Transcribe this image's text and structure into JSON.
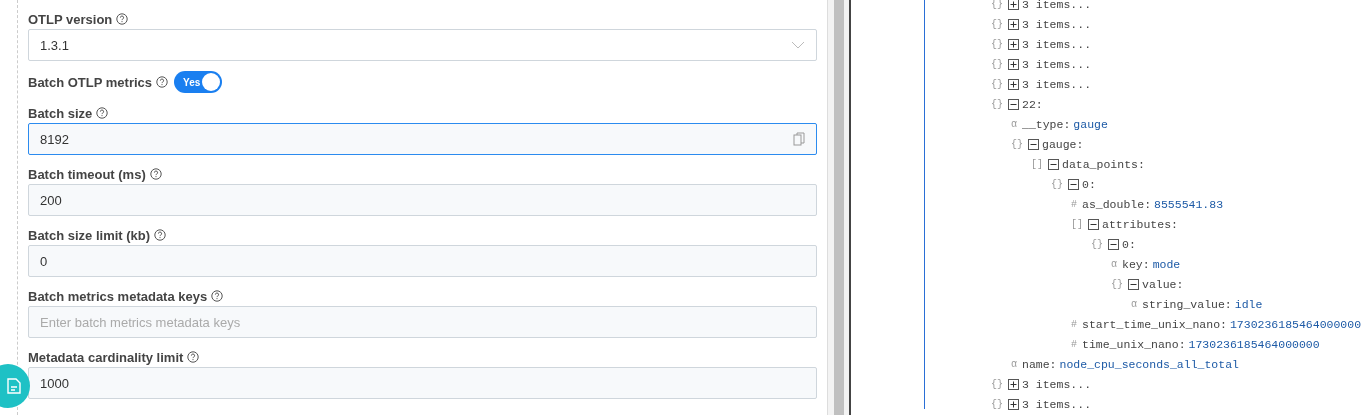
{
  "form": {
    "fields": [
      {
        "label": "OTLP version",
        "kind": "select",
        "value": "1.3.1",
        "focused": false
      },
      {
        "label": "Batch OTLP metrics",
        "kind": "toggle",
        "on": true,
        "toggle_text": "Yes"
      },
      {
        "label": "Batch size",
        "kind": "input",
        "value": "8192",
        "focused": true
      },
      {
        "label": "Batch timeout (ms)",
        "kind": "input",
        "value": "200",
        "focused": false
      },
      {
        "label": "Batch size limit (kb)",
        "kind": "input",
        "value": "0",
        "focused": false
      },
      {
        "label": "Batch metrics metadata keys",
        "kind": "input",
        "placeholder": "Enter batch metrics metadata keys",
        "focused": false
      },
      {
        "label": "Metadata cardinality limit",
        "kind": "input",
        "value": "1000",
        "focused": false
      }
    ]
  },
  "tree": [
    {
      "icon": "{}",
      "text": "3 items...",
      "expanded": false
    },
    {
      "icon": "{}",
      "text": "3 items...",
      "expanded": false
    },
    {
      "icon": "{}",
      "text": "3 items...",
      "expanded": false
    },
    {
      "icon": "{}",
      "text": "3 items...",
      "expanded": false
    },
    {
      "icon": "{}",
      "text": "3 items...",
      "expanded": false
    },
    {
      "icon": "{}",
      "text": "22:",
      "expanded": true,
      "children": [
        {
          "icon": "α",
          "text": "__type:",
          "value": "gauge"
        },
        {
          "icon": "{}",
          "text": "gauge:",
          "expanded": true,
          "children": [
            {
              "icon": "[]",
              "text": "data_points:",
              "expanded": true,
              "children": [
                {
                  "icon": "{}",
                  "text": "0:",
                  "expanded": true,
                  "children": [
                    {
                      "icon": "#",
                      "text": "as_double:",
                      "value": "8555541.83"
                    },
                    {
                      "icon": "[]",
                      "text": "attributes:",
                      "expanded": true,
                      "children": [
                        {
                          "icon": "{}",
                          "text": "0:",
                          "expanded": true,
                          "children": [
                            {
                              "icon": "α",
                              "text": "key:",
                              "value": "mode"
                            },
                            {
                              "icon": "{}",
                              "text": "value:",
                              "expanded": true,
                              "children": [
                                {
                                  "icon": "α",
                                  "text": "string_value:",
                                  "value": "idle"
                                }
                              ]
                            }
                          ]
                        }
                      ]
                    },
                    {
                      "icon": "#",
                      "text": "start_time_unix_nano:",
                      "value": "1730236185464000000"
                    },
                    {
                      "icon": "#",
                      "text": "time_unix_nano:",
                      "value": "1730236185464000000"
                    }
                  ]
                }
              ]
            }
          ]
        },
        {
          "icon": "α",
          "text": "name:",
          "value": "node_cpu_seconds_all_total"
        }
      ]
    },
    {
      "icon": "{}",
      "text": "3 items...",
      "expanded": false
    },
    {
      "icon": "{}",
      "text": "3 items...",
      "expanded": false
    }
  ]
}
